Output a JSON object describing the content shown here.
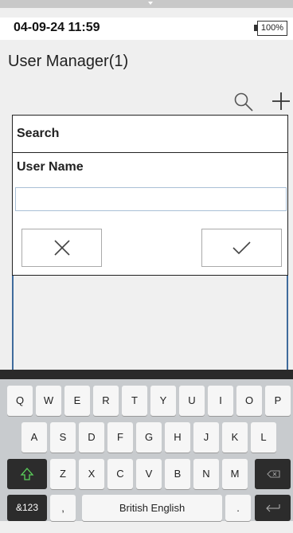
{
  "status": {
    "time": "04-09-24 11:59",
    "battery": "100%"
  },
  "page": {
    "title": "User Manager(1)"
  },
  "toolbar": {
    "search_icon": "search-icon",
    "add_icon": "plus-icon"
  },
  "dialog": {
    "title": "Search",
    "field_label": "User Name",
    "input_value": "",
    "cancel_icon": "close-icon",
    "confirm_icon": "checkmark-icon"
  },
  "keyboard": {
    "row1": [
      "Q",
      "W",
      "E",
      "R",
      "T",
      "Y",
      "U",
      "I",
      "O",
      "P"
    ],
    "row2": [
      "A",
      "S",
      "D",
      "F",
      "G",
      "H",
      "J",
      "K",
      "L"
    ],
    "row3": [
      "Z",
      "X",
      "C",
      "V",
      "B",
      "N",
      "M"
    ],
    "mode_label": "&123",
    "comma_label": ",",
    "space_label": "British English",
    "period_label": "."
  }
}
